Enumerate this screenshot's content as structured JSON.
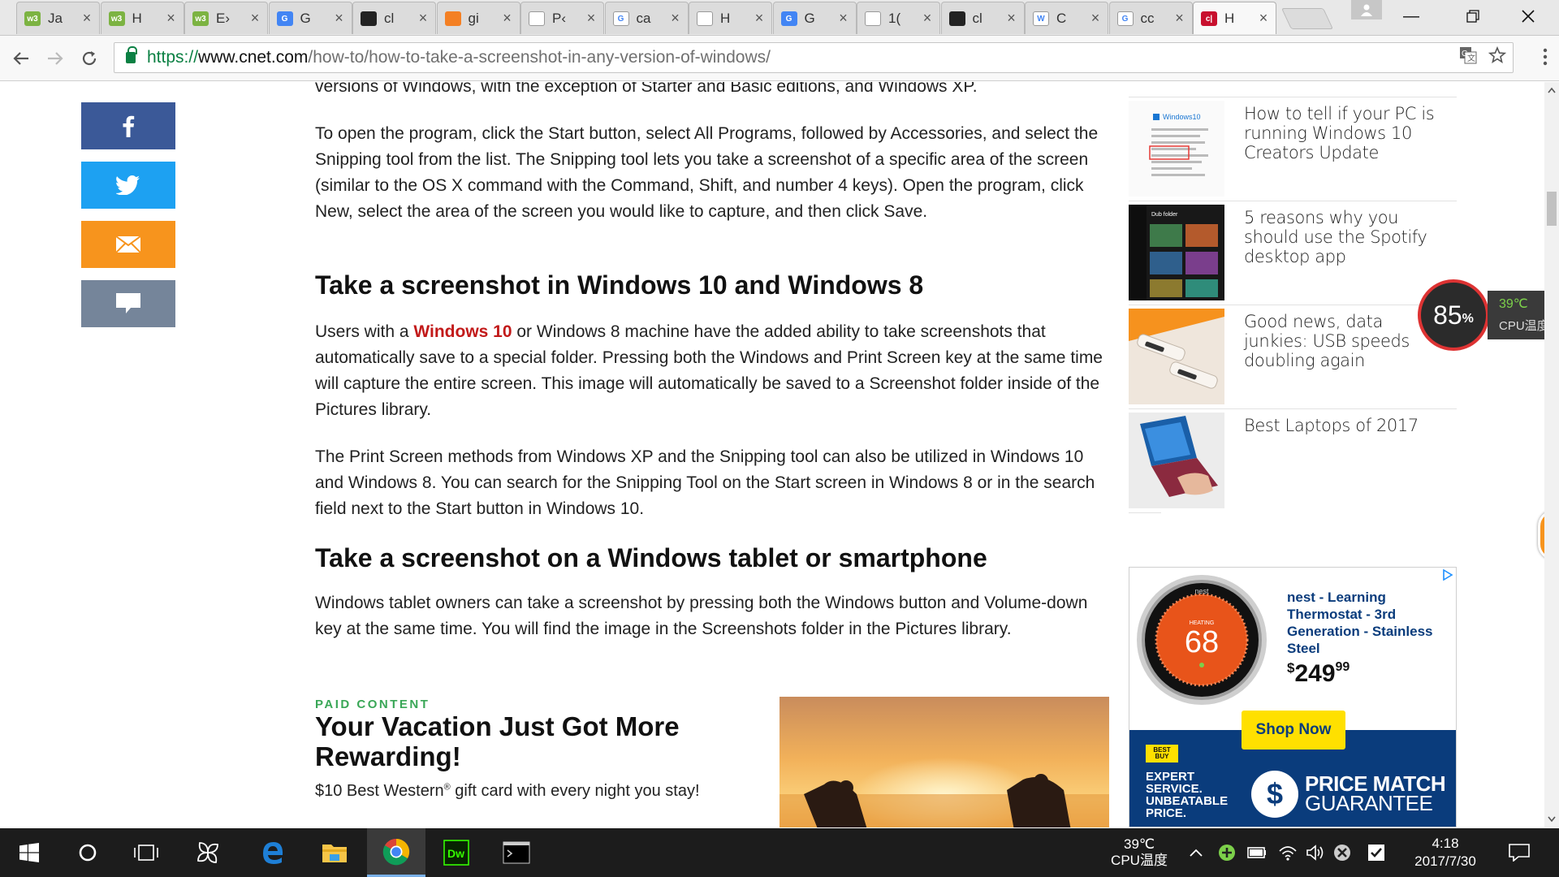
{
  "browser": {
    "tabs": [
      {
        "icon": "w3-icon",
        "title": "Ja",
        "color": "#7cb342",
        "mark": "w3"
      },
      {
        "icon": "w3-icon",
        "title": "H",
        "color": "#7cb342",
        "mark": "w3"
      },
      {
        "icon": "w3-icon",
        "title": "E›",
        "color": "#7cb342",
        "mark": "w3"
      },
      {
        "icon": "google-translate-icon",
        "title": "G",
        "color": "#4285f4",
        "mark": "G"
      },
      {
        "icon": "github-icon",
        "title": "cl",
        "color": "#222222",
        "mark": ""
      },
      {
        "icon": "stackoverflow-icon",
        "title": "gi",
        "color": "#f48024",
        "mark": ""
      },
      {
        "icon": "page-icon",
        "title": "P‹",
        "color": "#ffffff",
        "mark": ""
      },
      {
        "icon": "google-icon",
        "title": "ca",
        "color": "#ffffff",
        "mark": "G"
      },
      {
        "icon": "page-icon",
        "title": "H",
        "color": "#ffffff",
        "mark": ""
      },
      {
        "icon": "google-translate-icon",
        "title": "G",
        "color": "#4285f4",
        "mark": "G"
      },
      {
        "icon": "page-icon",
        "title": "1(",
        "color": "#ffffff",
        "mark": ""
      },
      {
        "icon": "github-icon",
        "title": "cl",
        "color": "#222222",
        "mark": ""
      },
      {
        "icon": "wikipedia-icon",
        "title": "C",
        "color": "#ffffff",
        "mark": "W"
      },
      {
        "icon": "google-icon",
        "title": "cc",
        "color": "#ffffff",
        "mark": "G"
      },
      {
        "icon": "cnet-icon",
        "title": "H",
        "color": "#c8102e",
        "mark": "c|"
      }
    ],
    "url": {
      "protocol": "https://",
      "host": "www.cnet.com",
      "path": "/how-to/how-to-take-a-screenshot-in-any-version-of-windows/"
    }
  },
  "article": {
    "p_top": "versions of Windows, with the exception of Starter and Basic editions, and Windows XP.",
    "p_snipping": "To open the program, click the Start button, select All Programs, followed by Accessories, and select the Snipping tool from the list. The Snipping tool lets you take a screenshot of a specific area of the screen (similar to the OS X command with the Command, Shift, and number 4 keys). Open the program, click New, select the area of the screen you would like to capture, and then click Save.",
    "h2_win10": "Take a screenshot in Windows 10 and Windows 8",
    "p_win10_pre": "Users with a ",
    "p_win10_link": "Windows 10",
    "p_win10_post": " or Windows 8 machine have the added ability to take screenshots that automatically save to a special folder. Pressing both the Windows and Print Screen key at the same time will capture the entire screen. This image will automatically be saved to a Screenshot folder inside of the Pictures library.",
    "p_printscreen": "The Print Screen methods from Windows XP and the Snipping tool can also be utilized in Windows 10 and Windows 8. You can search for the Snipping Tool on the Start screen in Windows 8 or in the search field next to the Start button in Windows 10.",
    "h2_tablet": "Take a screenshot on a Windows tablet or smartphone",
    "p_tablet": "Windows tablet owners can take a screenshot by pressing both the Windows button and Volume-down key at the same time. You will find the image in the Screenshots folder in the Pictures library.",
    "paid_label": "PAID CONTENT",
    "paid_title": "Your Vacation Just Got More Rewarding!",
    "paid_desc_pre": "$10 Best Western",
    "paid_desc_reg": "®",
    "paid_desc_post": " gift card with every night you stay!"
  },
  "related": [
    {
      "title": "How to tell if your PC is running Windows 10 Creators Update",
      "thumb_label": "Windows10"
    },
    {
      "title": "5 reasons why you should use the Spotify desktop app",
      "thumb_label": "Dub folder"
    },
    {
      "title": "Good news, data junkies: USB speeds doubling again",
      "thumb_label": ""
    },
    {
      "title": "Best Laptops of 2017",
      "thumb_label": ""
    }
  ],
  "ad": {
    "product": "nest - Learning Thermostat - 3rd Generation - Stainless Steel",
    "price_dollar": "$",
    "price_main": "249",
    "price_cents": "99",
    "thermostat_brand": "nest",
    "thermostat_mode": "HEATING",
    "thermostat_temp": "68",
    "button": "Shop Now",
    "bestbuy_tag": "BEST BUY",
    "tagline_1": "EXPERT",
    "tagline_2": "SERVICE.",
    "tagline_3": "UNBEATABLE",
    "tagline_4": "PRICE.",
    "guarantee_1": "PRICE MATCH",
    "guarantee_2": "GUARANTEE",
    "adchoices_icon": "adchoices-icon"
  },
  "cpu_widget": {
    "percent": "85",
    "percent_sign": "%",
    "temp": "39℃",
    "label": "CPU温度",
    "edge_value": "85"
  },
  "taskbar": {
    "cpu_temp": "39℃",
    "cpu_label": "CPU温度",
    "time": "4:18",
    "date": "2017/7/30"
  }
}
